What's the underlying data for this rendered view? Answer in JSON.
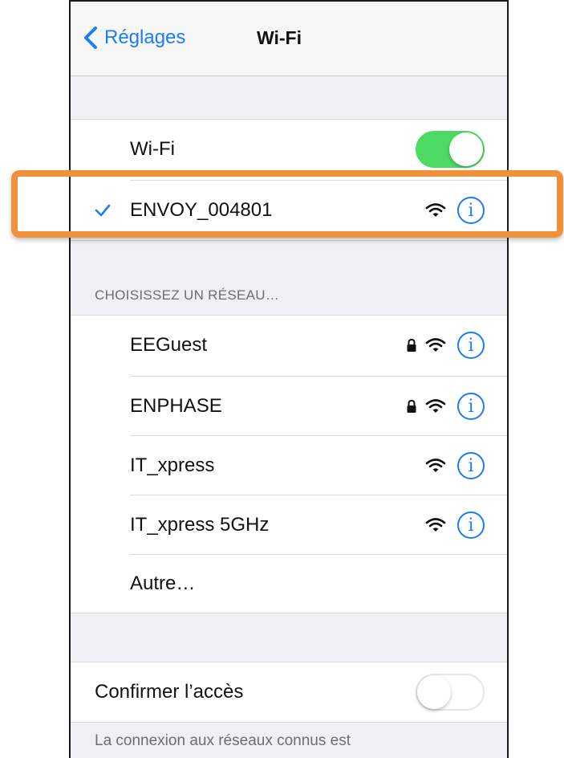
{
  "navbar": {
    "back_label": "Réglages",
    "title": "Wi-Fi"
  },
  "wifi_toggle": {
    "label": "Wi-Fi",
    "state": "on"
  },
  "connected_network": {
    "name": "ENVOY_004801",
    "info_glyph": "i"
  },
  "networks_section": {
    "header": "CHOISISSEZ UN RÉSEAU…"
  },
  "networks": [
    {
      "name": "EEGuest",
      "locked": true
    },
    {
      "name": "ENPHASE",
      "locked": true
    },
    {
      "name": "IT_xpress",
      "locked": false
    },
    {
      "name": "IT_xpress 5GHz",
      "locked": false
    }
  ],
  "other": {
    "label": "Autre…"
  },
  "ask_join": {
    "label": "Confirmer l’accès",
    "state": "off"
  },
  "footer": {
    "text": "La connexion aux réseaux connus est"
  },
  "colors": {
    "accent": "#1c7cf4",
    "toggle_on": "#4cd964",
    "highlight": "#f0903a"
  },
  "icons": [
    "chevron-left-icon",
    "checkmark-icon",
    "wifi-icon",
    "lock-icon",
    "info-icon"
  ]
}
